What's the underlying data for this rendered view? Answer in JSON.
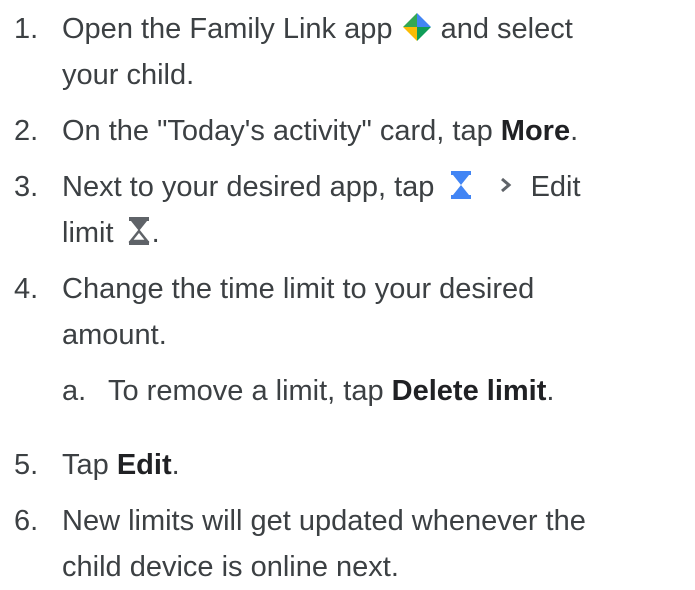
{
  "steps": [
    {
      "number": "1.",
      "line1_text": "Open the Family Link app",
      "line1_icon": "family-link-app-icon",
      "line1_tail": "and select",
      "line2_text": "your child."
    },
    {
      "number": "2.",
      "line1_text": "On the \"Today's activity\" card, tap",
      "line1_bold": "More",
      "line1_end": "."
    },
    {
      "number": "3.",
      "line1_text": "Next to your desired app, tap",
      "line1_icon1": "hourglass-icon-blue",
      "line1_icon2": "chevron-right-icon",
      "line1_tail": "Edit",
      "line2_text": "limit",
      "line2_icon": "hourglass-icon-gray",
      "line2_end": "."
    },
    {
      "number": "4.",
      "line1_text": "Change the time limit to your desired",
      "line2_text": "amount.",
      "sub": {
        "letter": "a.",
        "text": "To remove a limit, tap",
        "bold": "Delete limit",
        "end": "."
      }
    },
    {
      "number": "5.",
      "line1_text": "Tap",
      "line1_bold": "Edit",
      "line1_end": "."
    },
    {
      "number": "6.",
      "line1_text": "New limits will get updated whenever the",
      "line2_text": "child device is online next."
    }
  ],
  "colors": {
    "text": "#3c4043",
    "accent_blue": "#4285f4",
    "icon_gray": "#5f6368"
  }
}
